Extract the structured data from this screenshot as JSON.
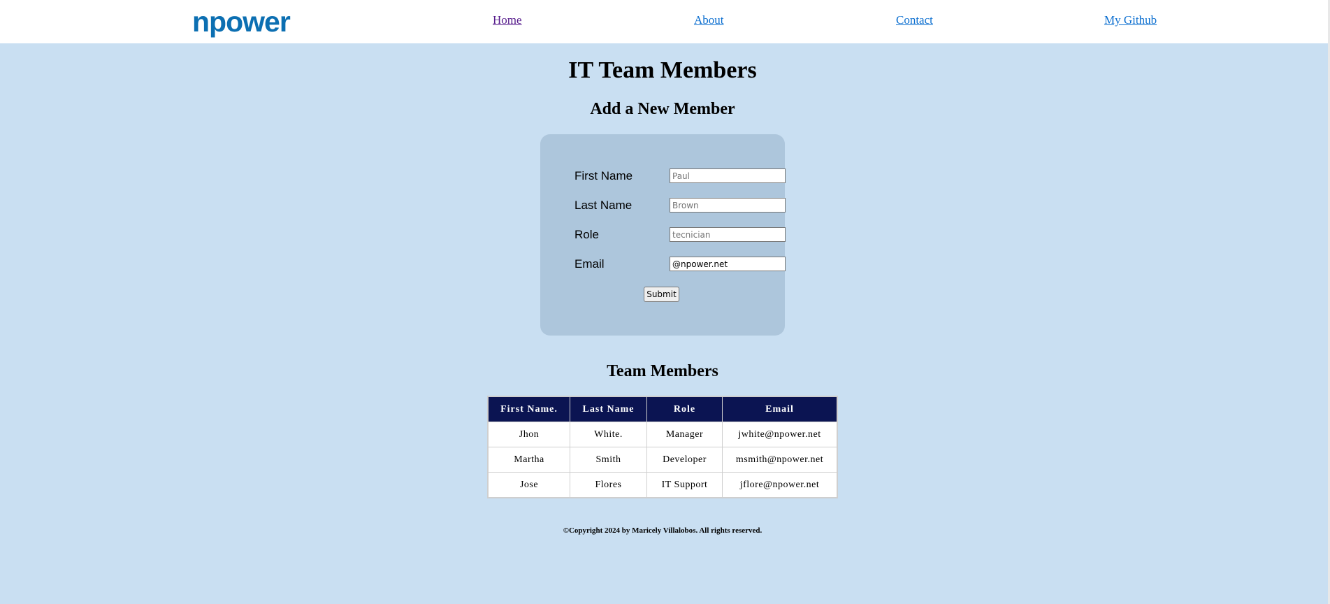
{
  "nav": {
    "logo": "npower",
    "links": [
      "Home",
      "About",
      "Contact",
      "My Github"
    ]
  },
  "page_title": "IT Team Members",
  "form": {
    "title": "Add a New Member",
    "fields": [
      {
        "label": "First Name",
        "value": "",
        "placeholder": "Paul"
      },
      {
        "label": "Last Name",
        "value": "",
        "placeholder": "Brown"
      },
      {
        "label": "Role",
        "value": "",
        "placeholder": "tecnician"
      },
      {
        "label": "Email",
        "value": "@npower.net",
        "placeholder": ""
      }
    ],
    "submit_label": "Submit"
  },
  "team": {
    "title": "Team Members",
    "headers": [
      "First Name.",
      "Last Name",
      "Role",
      "Email"
    ],
    "rows": [
      [
        "Jhon",
        "White.",
        "Manager",
        "jwhite@npower.net"
      ],
      [
        "Martha",
        "Smith",
        "Developer",
        "msmith@npower.net"
      ],
      [
        "Jose",
        "Flores",
        "IT Support",
        "jflore@npower.net"
      ]
    ]
  },
  "footer": "©Copyright 2024 by Maricely Villalobos. All rights reserved.",
  "colors": {
    "background": "#c9dff2",
    "form_box": "#adc6dc",
    "table_header": "#0b1452",
    "logo": "#0c6fb2",
    "link": "#0c6fd0",
    "visited_link": "#551a8b"
  }
}
